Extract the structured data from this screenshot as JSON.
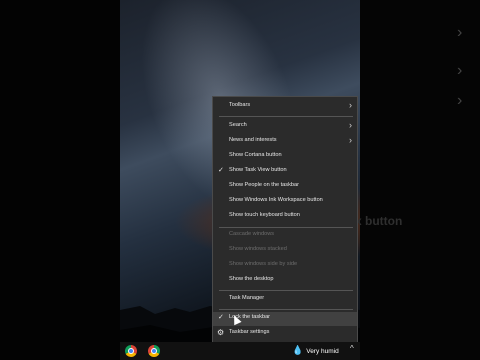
{
  "menu": {
    "items": [
      {
        "label": "Toolbars",
        "submenu": true
      },
      {
        "label": "Search",
        "submenu": true
      },
      {
        "label": "News and interests",
        "submenu": true
      },
      {
        "label": "Show Cortana button"
      },
      {
        "label": "Show Task View button",
        "checked": true
      },
      {
        "label": "Show People on the taskbar"
      },
      {
        "label": "Show Windows Ink Workspace button"
      },
      {
        "label": "Show touch keyboard button"
      },
      {
        "label": "Cascade windows",
        "disabled": true
      },
      {
        "label": "Show windows stacked",
        "disabled": true
      },
      {
        "label": "Show windows side by side",
        "disabled": true
      },
      {
        "label": "Show the desktop"
      },
      {
        "label": "Task Manager"
      },
      {
        "label": "Lock the taskbar",
        "checked": true
      },
      {
        "label": "Taskbar settings",
        "icon": "gear-icon"
      }
    ],
    "check_glyph": "✓",
    "chevron_glyph": "›",
    "gear_glyph": "⚙"
  },
  "taskbar": {
    "weather_text": "Very humid",
    "weather_icon": "water-drop-icon",
    "tray_chevron": "^"
  },
  "background": {
    "ghost_text": "x button"
  }
}
